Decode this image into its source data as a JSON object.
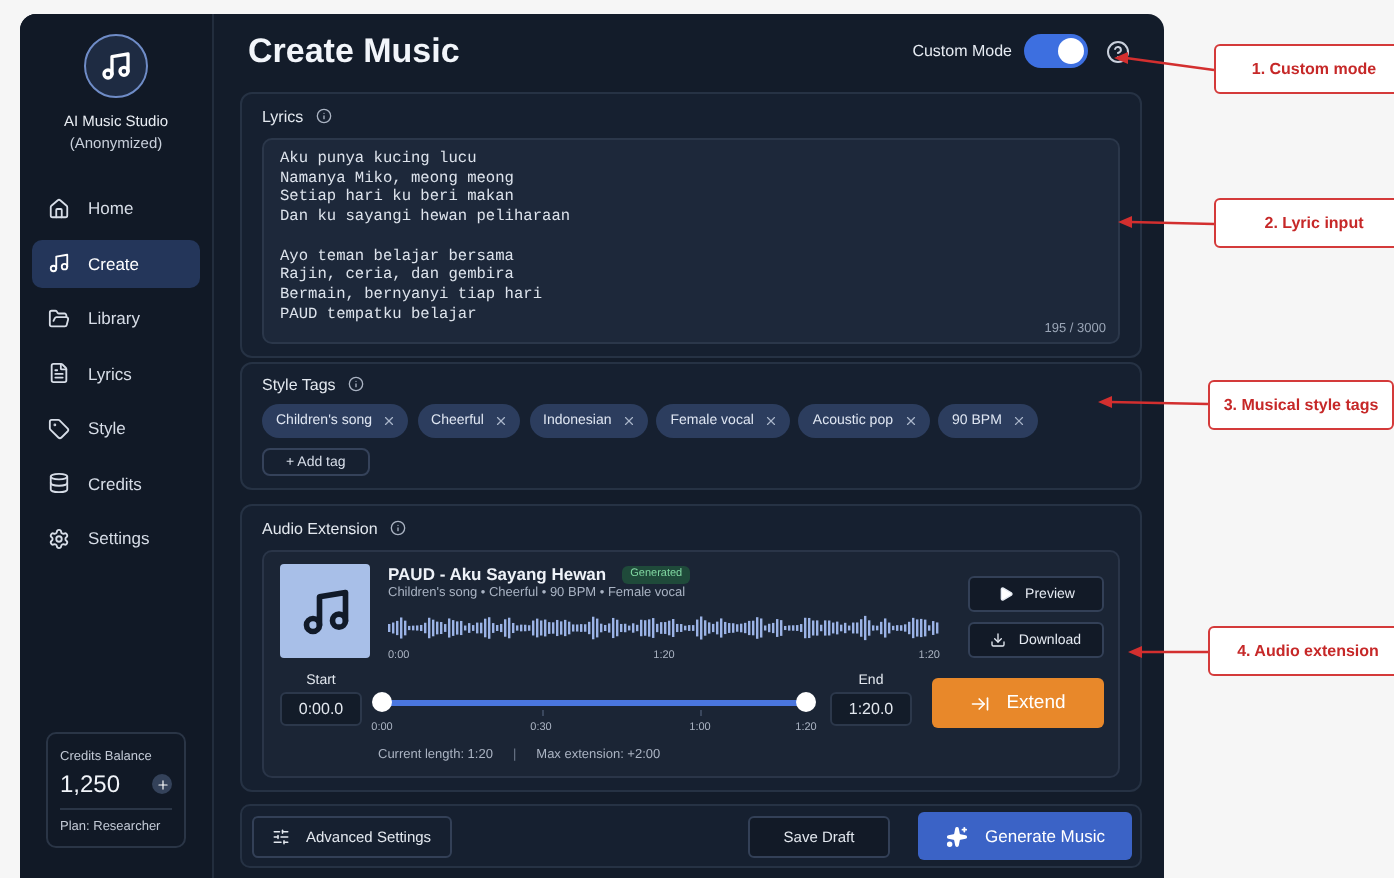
{
  "sidebar": {
    "app_name": "AI Music Studio",
    "app_subtitle": "(Anonymized)",
    "items": [
      {
        "label": "Home",
        "selected": false
      },
      {
        "label": "Create",
        "selected": true
      },
      {
        "label": "Library",
        "selected": false
      },
      {
        "label": "Lyrics",
        "selected": false
      },
      {
        "label": "Style",
        "selected": false
      },
      {
        "label": "Credits",
        "selected": false
      },
      {
        "label": "Settings",
        "selected": false
      }
    ],
    "credits": {
      "label": "Credits Balance",
      "amount": "1,250",
      "plan": "Plan: Researcher"
    }
  },
  "header": {
    "title": "Create Music",
    "custom_mode": {
      "label": "Custom Mode",
      "on": true
    }
  },
  "lyrics": {
    "title": "Lyrics",
    "value": "Aku punya kucing lucu\nNamanya Miko, meong meong\nSetiap hari ku beri makan\nDan ku sayangi hewan peliharaan\n\nAyo teman belajar bersama\nRajin, ceria, dan gembira\nBermain, bernyanyi tiap hari\nPAUD tempatku belajar",
    "count": "195 / 3000"
  },
  "style_tags": {
    "title": "Style Tags",
    "tags": [
      "Children's song",
      "Cheerful",
      "Indonesian",
      "Female vocal",
      "Acoustic pop",
      "90 BPM"
    ],
    "add_label": "+ Add tag"
  },
  "audio_extension": {
    "title": "Audio Extension",
    "track_title": "PAUD - Aku Sayang Hewan",
    "badge": "Generated",
    "meta": "Children's song • Cheerful • 90 BPM • Female vocal",
    "wave_times": [
      "0:00",
      "1:20",
      "1:20"
    ],
    "preview": "Preview",
    "download": "Download",
    "start_label": "Start",
    "start_value": "0:00.0",
    "end_label": "End",
    "end_value": "1:20.0",
    "start_handle": {
      "level": 0
    },
    "end_handle": {
      "level": 1
    },
    "ticks": [
      "0:00",
      "0:30",
      "1:00",
      "1:20"
    ],
    "current_length": "Current length: 1:20",
    "separator": "|",
    "max_extension": "Max extension: +2:00",
    "extend": "Extend"
  },
  "footer": {
    "advanced": "Advanced Settings",
    "save": "Save Draft",
    "generate": "Generate Music"
  },
  "annotations": [
    "1. Custom mode",
    "2. Lyric input",
    "3. Musical style tags",
    "4. Audio extension"
  ]
}
